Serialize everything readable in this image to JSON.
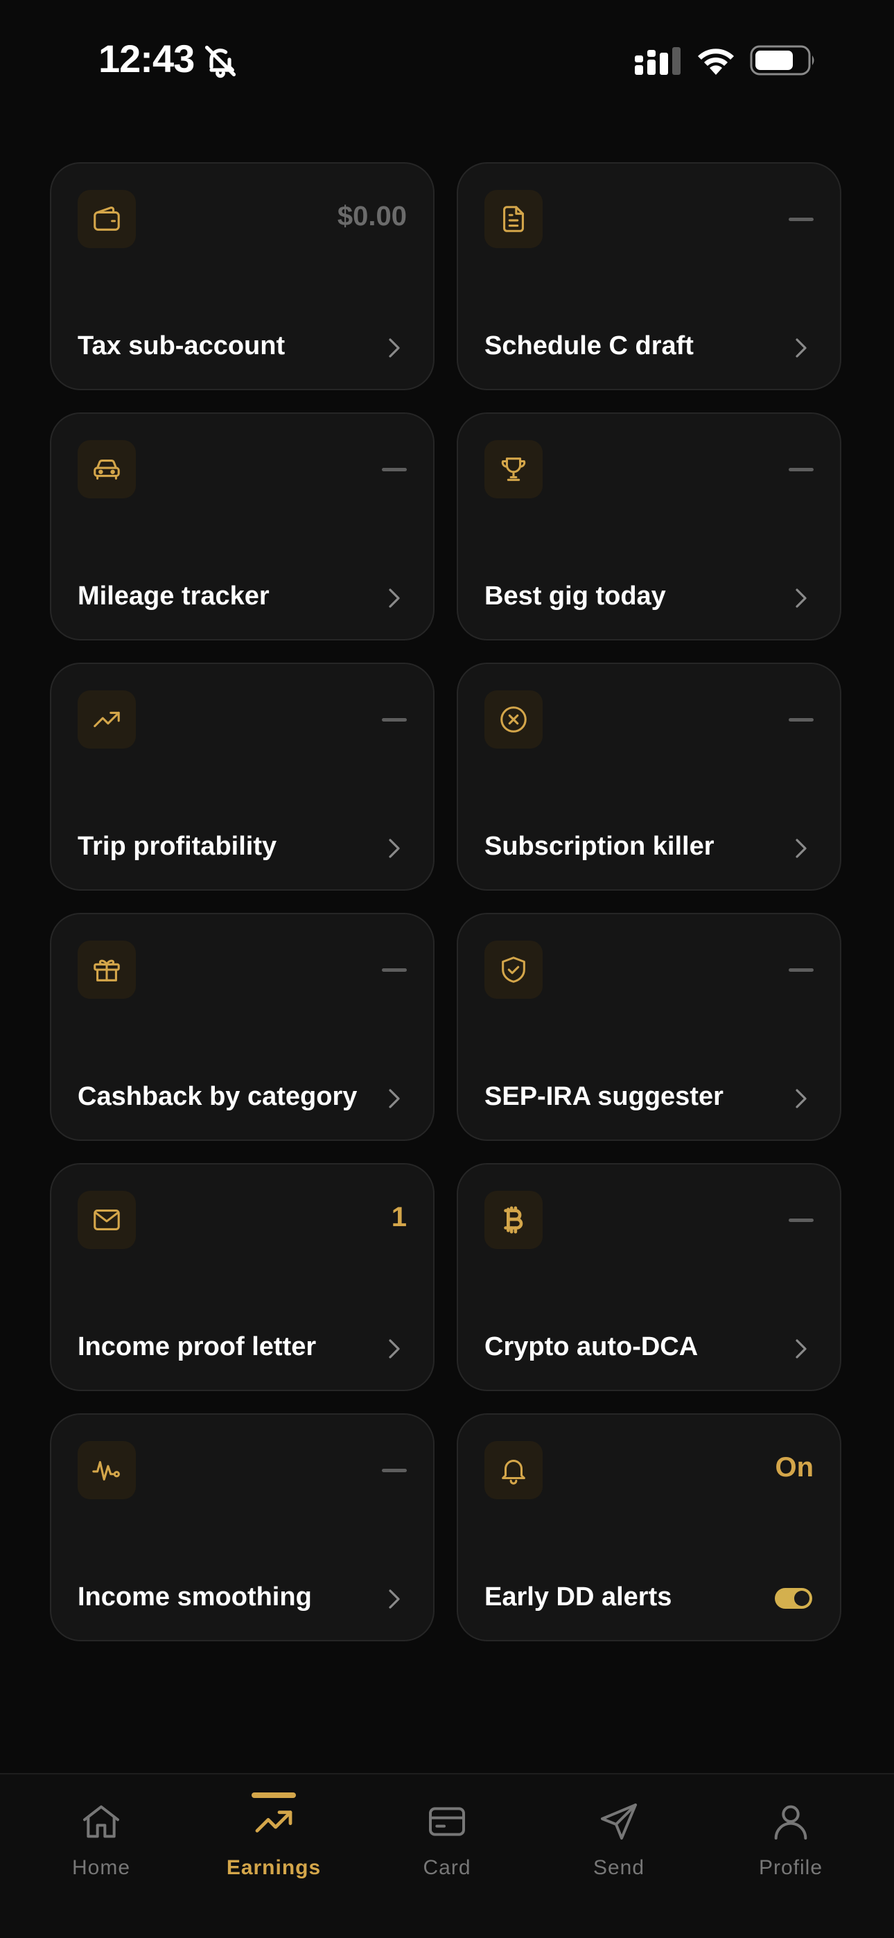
{
  "status_bar": {
    "time": "12:43"
  },
  "tiles": [
    {
      "icon": "wallet-icon",
      "value": "$0.00",
      "value_style": "muted",
      "label": "Tax sub-account",
      "trailing": "chevron"
    },
    {
      "icon": "document-icon",
      "value": null,
      "label": "Schedule C draft",
      "trailing": "chevron"
    },
    {
      "icon": "car-icon",
      "value": null,
      "label": "Mileage tracker",
      "trailing": "chevron"
    },
    {
      "icon": "trophy-icon",
      "value": null,
      "label": "Best gig today",
      "trailing": "chevron"
    },
    {
      "icon": "trending-up-icon",
      "value": null,
      "label": "Trip profitability",
      "trailing": "chevron"
    },
    {
      "icon": "x-circle-icon",
      "value": null,
      "label": "Subscription killer",
      "trailing": "chevron"
    },
    {
      "icon": "gift-icon",
      "value": null,
      "label": "Cashback by category",
      "trailing": "chevron"
    },
    {
      "icon": "shield-check-icon",
      "value": null,
      "label": "SEP-IRA suggester",
      "trailing": "chevron"
    },
    {
      "icon": "mail-icon",
      "value": "1",
      "value_style": "accent",
      "label": "Income proof letter",
      "trailing": "chevron"
    },
    {
      "icon": "bitcoin-icon",
      "value": null,
      "label": "Crypto auto-DCA",
      "trailing": "chevron"
    },
    {
      "icon": "pulse-icon",
      "value": null,
      "label": "Income smoothing",
      "trailing": "chevron"
    },
    {
      "icon": "bell-icon",
      "value": "On",
      "value_style": "accent",
      "label": "Early DD alerts",
      "trailing": "toggle",
      "toggle_on": true
    }
  ],
  "tab_bar": {
    "tabs": [
      {
        "label": "Home",
        "icon": "home-icon",
        "active": false
      },
      {
        "label": "Earnings",
        "icon": "trending-up-icon",
        "active": true
      },
      {
        "label": "Card",
        "icon": "card-icon",
        "active": false
      },
      {
        "label": "Send",
        "icon": "send-icon",
        "active": false
      },
      {
        "label": "Profile",
        "icon": "profile-icon",
        "active": false
      }
    ]
  },
  "colors": {
    "background": "#0a0a0a",
    "card": "#151515",
    "accent": "#d4a64a",
    "muted": "#6b6b6b"
  }
}
